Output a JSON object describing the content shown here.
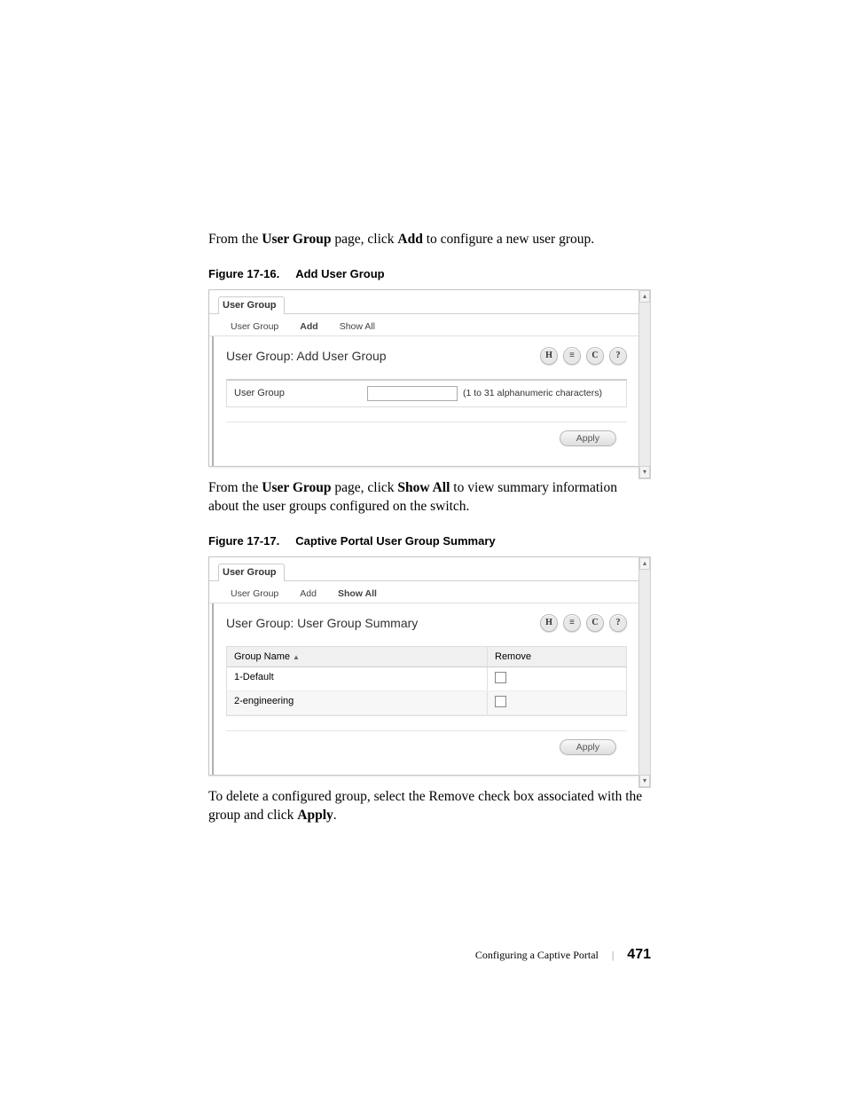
{
  "para1": {
    "pre": "From the ",
    "b1": "User Group",
    "mid": " page, click ",
    "b2": "Add",
    "post": " to configure a new user group."
  },
  "fig16": {
    "label": "Figure 17-16.",
    "title": "Add User Group"
  },
  "fig17": {
    "label": "Figure 17-17.",
    "title": "Captive Portal User Group Summary"
  },
  "para2": {
    "pre": "From the ",
    "b1": "User Group",
    "mid": " page, click ",
    "b2": "Show All",
    "post": " to view summary information about the user groups configured on the switch."
  },
  "para3": {
    "pre": "To delete a configured group, select the Remove check box associated with the group and click ",
    "b1": "Apply",
    "post": "."
  },
  "ui": {
    "main_tab": "User Group",
    "subtabs": {
      "user_group": "User Group",
      "add": "Add",
      "show_all": "Show All"
    },
    "title_add": "User Group: Add User Group",
    "title_summary": "User Group: User Group Summary",
    "form_label": "User Group",
    "form_hint": "(1 to 31 alphanumeric characters)",
    "apply": "Apply",
    "col_group_name": "Group Name",
    "col_remove": "Remove",
    "rows": {
      "r1": "1-Default",
      "r2": "2-engineering"
    },
    "icons": {
      "save": "H",
      "print": "≡",
      "refresh": "C",
      "help": "?"
    }
  },
  "footer": {
    "section": "Configuring a Captive Portal",
    "page": "471"
  }
}
